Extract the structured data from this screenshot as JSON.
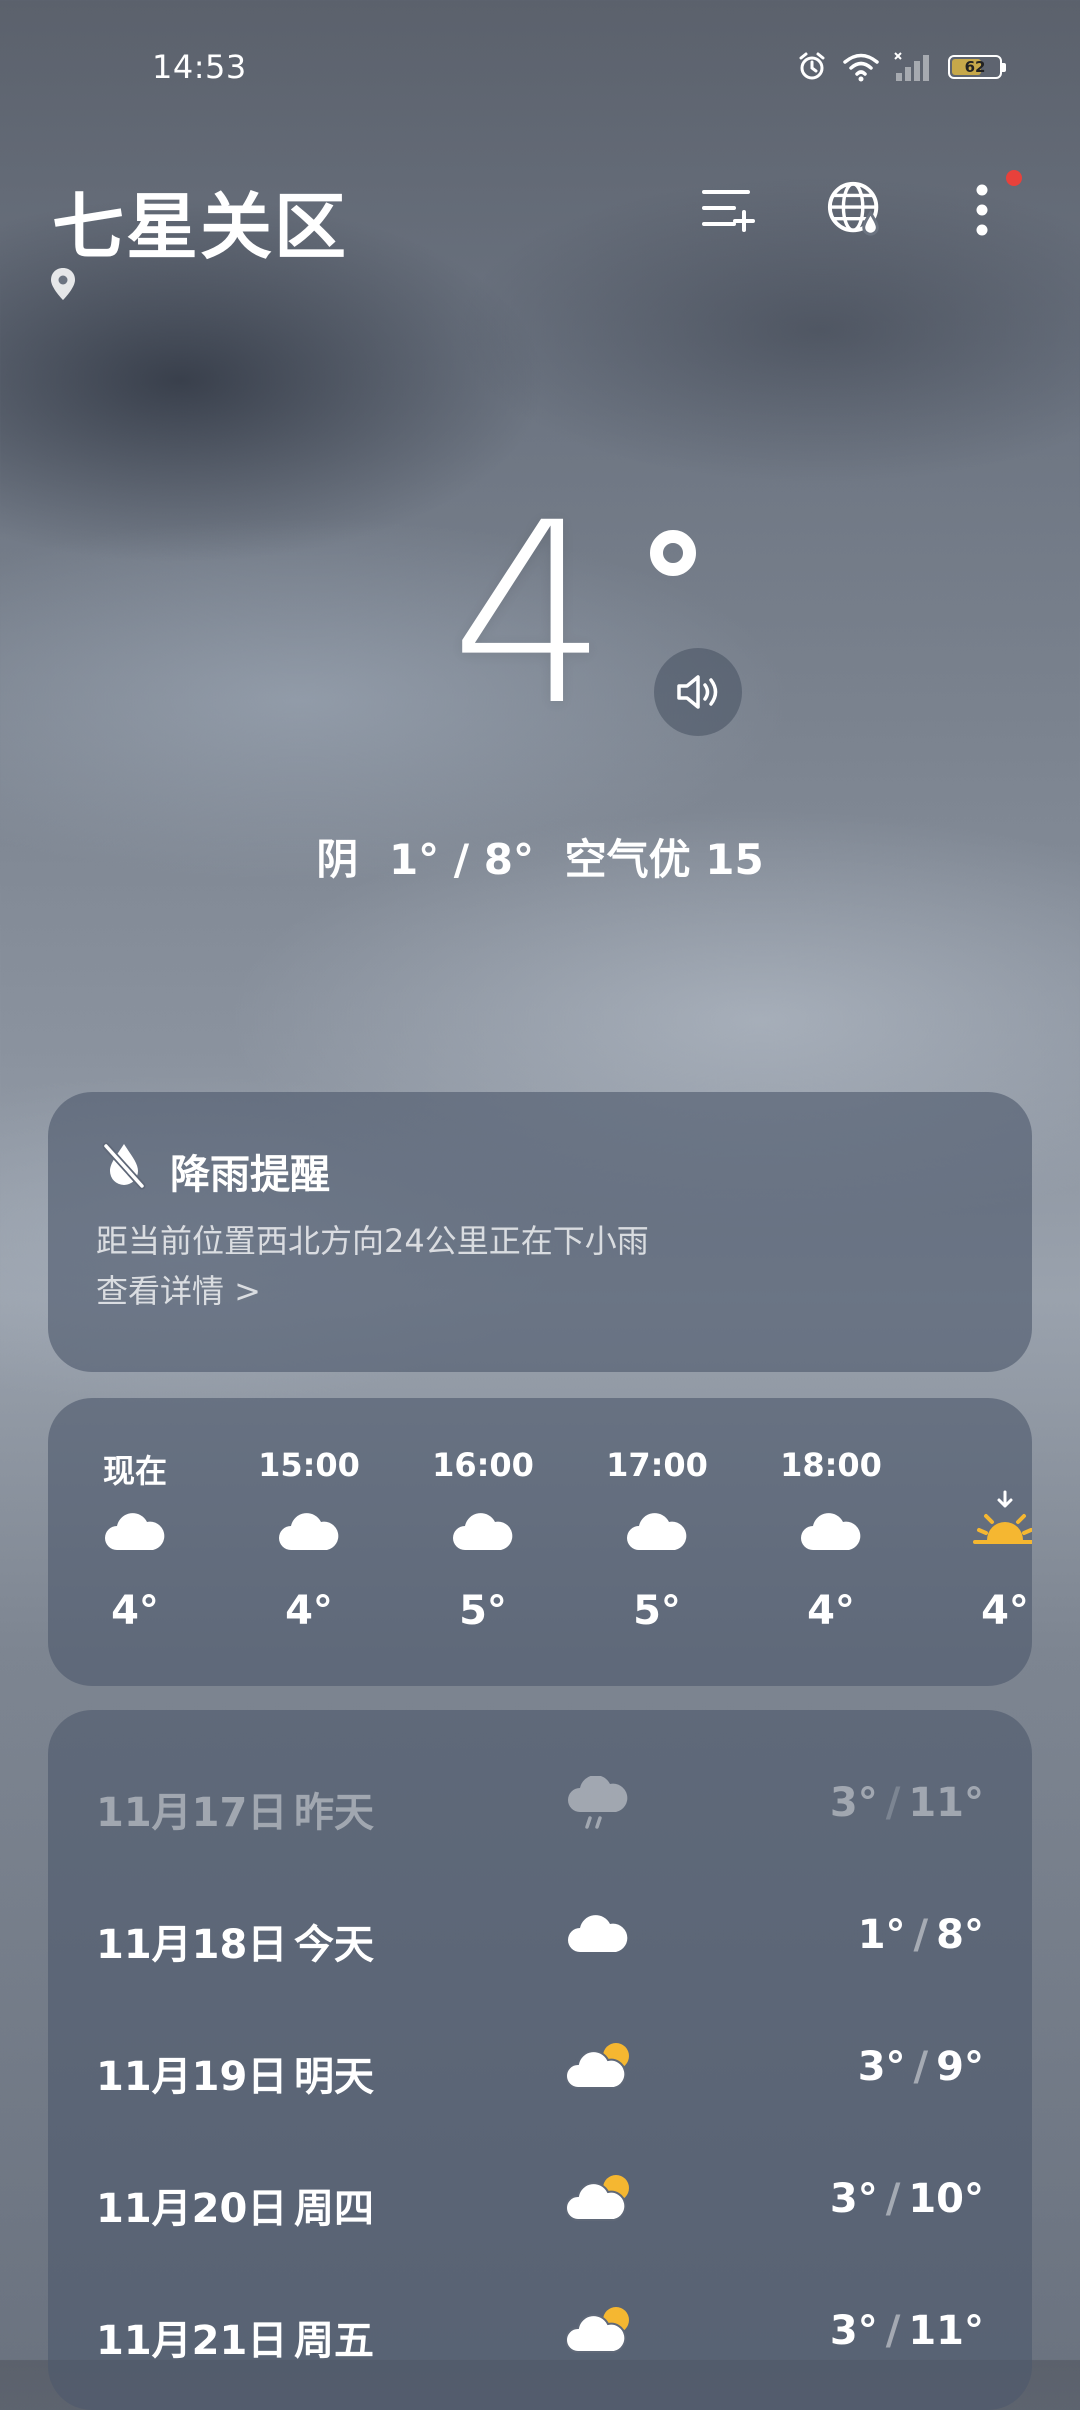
{
  "status": {
    "time": "14:53",
    "battery": "62",
    "battery_level": 0.62
  },
  "header": {
    "city": "七星关区"
  },
  "current": {
    "temp": "4",
    "condition": "阴",
    "range": "1° / 8°",
    "aqi": "空气优 15"
  },
  "alert": {
    "title": "降雨提醒",
    "description": "距当前位置西北方向24公里正在下小雨",
    "link": "查看详情 >"
  },
  "hourly": [
    {
      "time": "现在",
      "temp": "4°",
      "icon": "cloud-icon"
    },
    {
      "time": "15:00",
      "temp": "4°",
      "icon": "cloud-icon"
    },
    {
      "time": "16:00",
      "temp": "5°",
      "icon": "cloud-icon"
    },
    {
      "time": "17:00",
      "temp": "5°",
      "icon": "cloud-icon"
    },
    {
      "time": "18:00",
      "temp": "4°",
      "icon": "cloud-icon"
    },
    {
      "time": "",
      "temp": "4°",
      "icon": "sunset-icon"
    }
  ],
  "daily": [
    {
      "date": "11月17日",
      "label": "昨天",
      "low": "3°",
      "high": "11°",
      "icon": "rain-cloud-icon"
    },
    {
      "date": "11月18日",
      "label": "今天",
      "low": "1°",
      "high": "8°",
      "icon": "cloud-icon"
    },
    {
      "date": "11月19日",
      "label": "明天",
      "low": "3°",
      "high": "9°",
      "icon": "partly-cloudy-icon"
    },
    {
      "date": "11月20日",
      "label": "周四",
      "low": "3°",
      "high": "10°",
      "icon": "partly-cloudy-icon"
    },
    {
      "date": "11月21日",
      "label": "周五",
      "low": "3°",
      "high": "11°",
      "icon": "partly-cloudy-icon"
    }
  ],
  "colors": {
    "sun": "#f5b731",
    "alert_dot": "#e8413b",
    "card": "#4e586c"
  }
}
